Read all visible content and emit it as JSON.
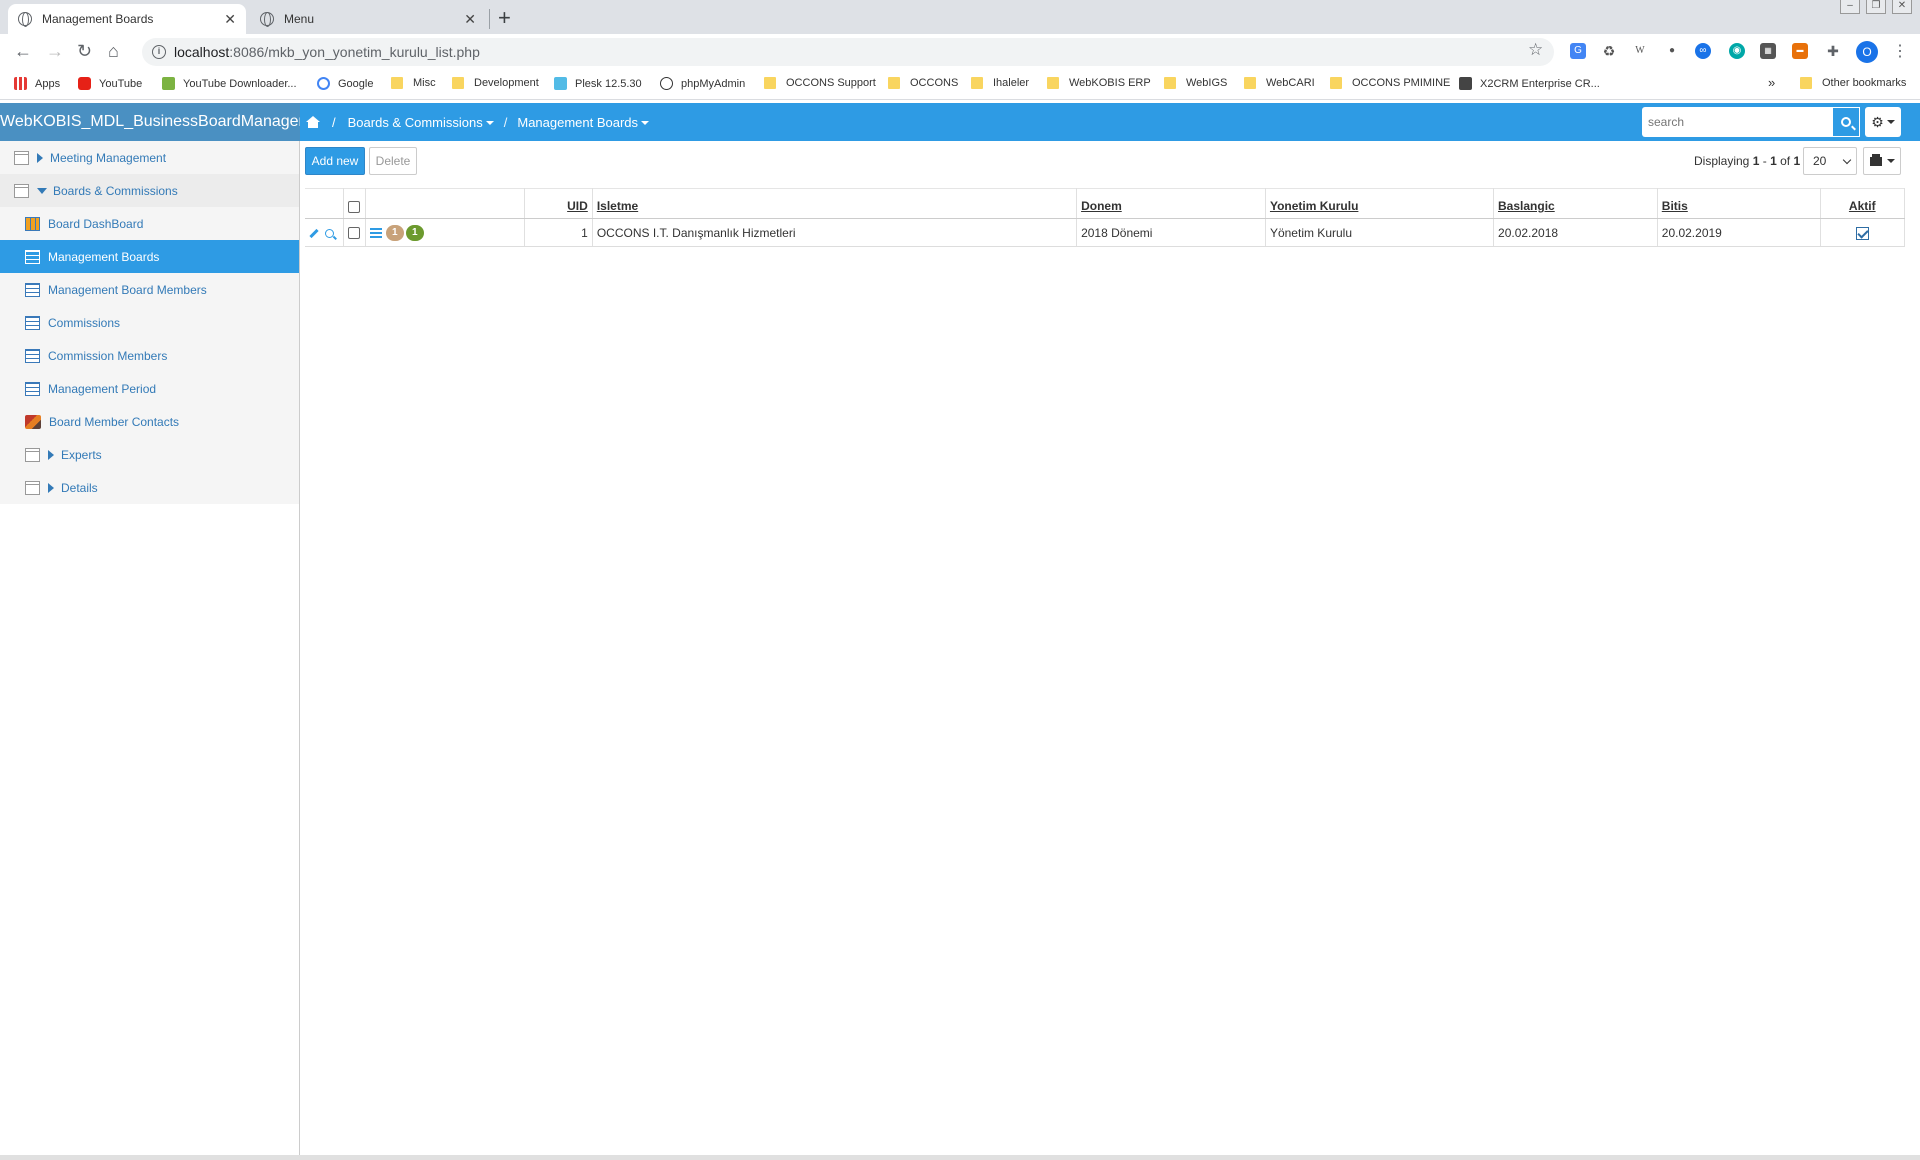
{
  "browser": {
    "tabs": [
      {
        "title": "Management Boards",
        "close": "✕"
      },
      {
        "title": "Menu",
        "close": "✕"
      }
    ],
    "new_tab": "+",
    "url_host": "localhost",
    "url_path": ":8086/mkb_yon_yonetim_kurulu_list.php",
    "profile_initial": "O",
    "bookmarks": [
      {
        "label": "Apps"
      },
      {
        "label": "YouTube"
      },
      {
        "label": "YouTube Downloader..."
      },
      {
        "label": "Google"
      },
      {
        "label": "Misc"
      },
      {
        "label": "Development"
      },
      {
        "label": "Plesk 12.5.30"
      },
      {
        "label": "phpMyAdmin"
      },
      {
        "label": "OCCONS Support"
      },
      {
        "label": "OCCONS"
      },
      {
        "label": "Ihaleler"
      },
      {
        "label": "WebKOBIS ERP"
      },
      {
        "label": "WebIGS"
      },
      {
        "label": "WebCARI"
      },
      {
        "label": "OCCONS PMIMINE"
      },
      {
        "label": "X2CRM Enterprise CR..."
      },
      {
        "label": "»"
      },
      {
        "label": "Other bookmarks"
      }
    ]
  },
  "app": {
    "brand": "WebKOBIS_MDL_BusinessBoardManagement",
    "breadcrumb": [
      "Boards & Commissions",
      "Management Boards"
    ],
    "breadcrumb_sep": "/",
    "search_placeholder": "search"
  },
  "sidebar": {
    "items": [
      {
        "label": "Meeting Management"
      },
      {
        "label": "Boards & Commissions"
      },
      {
        "label": "Board DashBoard"
      },
      {
        "label": "Management Boards"
      },
      {
        "label": "Management Board Members"
      },
      {
        "label": "Commissions"
      },
      {
        "label": "Commission Members"
      },
      {
        "label": "Management Period"
      },
      {
        "label": "Board Member Contacts"
      },
      {
        "label": "Experts"
      },
      {
        "label": "Details"
      }
    ]
  },
  "toolbar": {
    "add_label": "Add new",
    "delete_label": "Delete",
    "displaying_prefix": "Displaying ",
    "range_start": "1",
    "range_dash": " - ",
    "range_end": "1",
    "of_word": " of ",
    "total": "1",
    "page_size": "20"
  },
  "table": {
    "columns": [
      "UID",
      "Isletme",
      "Donem",
      "Yonetim Kurulu",
      "Baslangic",
      "Bitis",
      "Aktif"
    ],
    "rows": [
      {
        "badge1": "1",
        "badge2": "1",
        "uid": "1",
        "isletme": "OCCONS I.T. Danışmanlık Hizmetleri",
        "donem": "2018 Dönemi",
        "yonetim_kurulu": "Yönetim Kurulu",
        "baslangic": "20.02.2018",
        "bitis": "20.02.2019",
        "aktif": true
      }
    ]
  },
  "colors": {
    "accent": "#2e9be4",
    "brand_bg": "#4a90c2",
    "badge_tan": "#c8a27a",
    "badge_green": "#6c9a2e"
  }
}
